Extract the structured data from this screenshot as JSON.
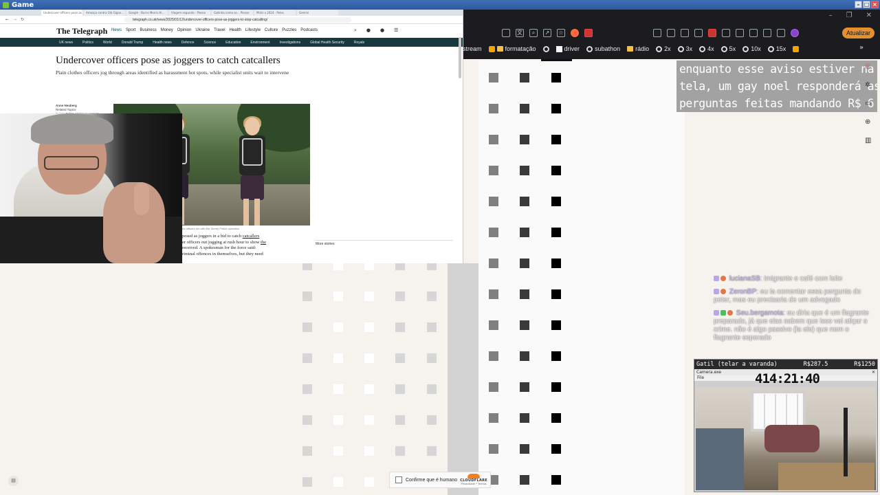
{
  "window": {
    "title": "Game"
  },
  "browser": {
    "tabs": [
      "Undercover officers pose as...",
      "Ameaça contra Olá Gigan...",
      "Google - Burns Morris Hi...",
      "Viagem segunda - Piesso",
      "Gatinha como se... Piesso",
      "Miniz x 2024 - Pelos",
      "Gemini"
    ],
    "url": "telegraph.co.uk/news/2025/01/12/undercover-officers-pose-as-joggers-to-stop-catcalling/",
    "site_logo": "The Telegraph",
    "main_nav": [
      "News",
      "Sport",
      "Business",
      "Money",
      "Opinion",
      "Ukraine",
      "Travel",
      "Health",
      "Lifestyle",
      "Culture",
      "Puzzles",
      "Podcasts"
    ],
    "sub_nav": [
      "UK news",
      "Politics",
      "World",
      "Donald Trump",
      "Health news",
      "Defence",
      "Science",
      "Education",
      "Environment",
      "Investigations",
      "Global Health Security",
      "Royals"
    ],
    "article": {
      "headline": "Undercover officers pose as joggers to catch catcallers",
      "standfirst": "Plain clothes officers jog through areas identified as harassment hot spots, while specialist units wait to intervene",
      "byline_name": "Anne Neuberg",
      "byline_lines": [
        "Related Topics",
        "Surrey Police, Violence against",
        "Women, Sexual harassment, Surrey,",
        "12 January 2025 • 5:00am"
      ],
      "caption": "Plain clothes officers run with the Surrey Police operation",
      "body_lines": [
        "posed as joggers in a bid to catch ",
        "catcallers",
        "er officers out jogging at rush hour to show ",
        "the",
        "received. A spokesman for the force said:",
        "riminal offences in themselves, but they need"
      ],
      "more_stories": "More stories"
    }
  },
  "dark_browser": {
    "update_button": "Atualizar",
    "bookmarks": [
      "stream",
      "formatação",
      "driver",
      "subathon",
      "rádio",
      "2x",
      "3x",
      "4x",
      "5x",
      "10x",
      "15x"
    ]
  },
  "aviso_lines": [
    "enquanto esse aviso estiver na",
    "tela, um gay noel responderá as",
    "perguntas feitas mandando R$ 6"
  ],
  "chat": [
    {
      "user": "lucianaSB",
      "text": ": imigrante e café com leite"
    },
    {
      "user": "ZeronBP",
      "text": ": eu ia comentar essa pergunta do peter, mas eu precisaria de um advogado"
    },
    {
      "user": "Seu.bergamota",
      "text": ": eu diria que é um flagrante preparado, já que elas sabem que isso vai atiçar o crime. não é algo passivo (la ele) que nem o flagrante esperado"
    }
  ],
  "catcam": {
    "title": "Gatil (telar a varanda)",
    "amount_mid": "R$287.5",
    "amount_right": "R$1250",
    "window_title": "Camera.exe",
    "menu": "File",
    "timer": "414:21:40"
  },
  "captcha": {
    "label": "Confirme que é humano",
    "brand": "CLOUDFLARE",
    "links": "Privacidade • Termos"
  },
  "colors": {
    "accent": "#e4902d",
    "subnav_bg": "#17383f",
    "overlay": "#a2a2a2"
  }
}
